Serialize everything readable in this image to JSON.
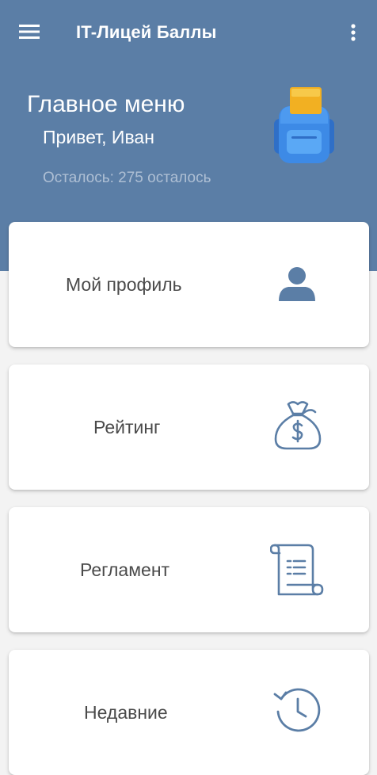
{
  "appbar": {
    "title": "IT-Лицей Баллы",
    "menu_icon": "hamburger-menu-icon",
    "overflow_icon": "more-vertical-icon"
  },
  "header": {
    "title": "Главное меню",
    "greeting": "Привет, Иван",
    "remaining": "Осталось: 275 осталось",
    "illustration": "backpack-icon"
  },
  "menu": {
    "items": [
      {
        "label": "Мой профиль",
        "icon": "person-icon"
      },
      {
        "label": "Рейтинг",
        "icon": "money-bag-icon"
      },
      {
        "label": "Регламент",
        "icon": "scroll-document-icon"
      },
      {
        "label": "Недавние",
        "icon": "history-clock-icon"
      }
    ]
  },
  "colors": {
    "primary": "#5b7ea6",
    "background": "#f3f3f3",
    "card": "#ffffff",
    "text": "#4a4a4a",
    "icon": "#5b7ea6",
    "muted": "#aebfd4"
  }
}
